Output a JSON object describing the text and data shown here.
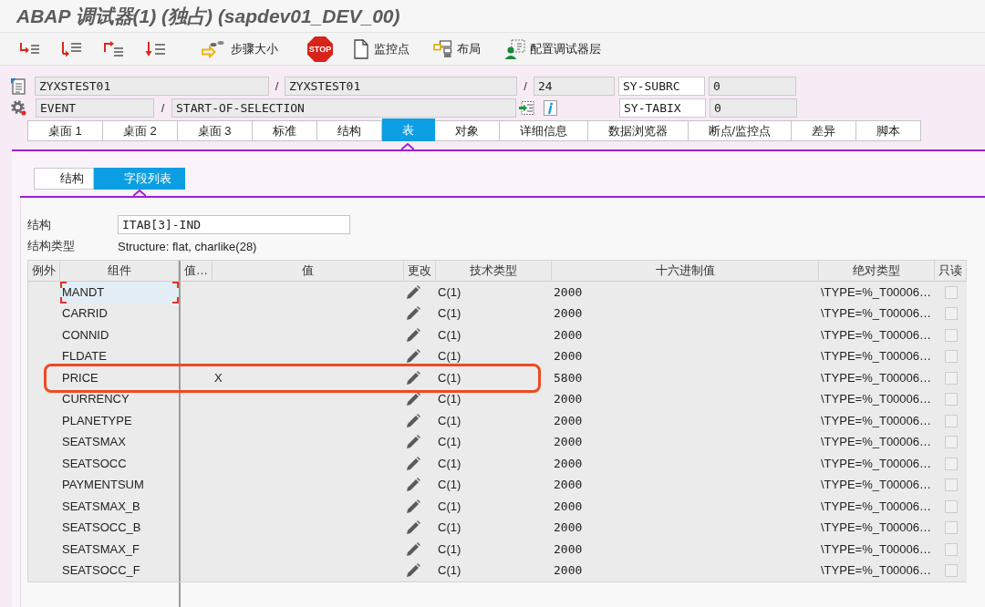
{
  "window": {
    "title": "ABAP 调试器(1) (独占) (sapdev01_DEV_00)"
  },
  "toolbar": {
    "buttons": [
      {
        "kind": "step-into"
      },
      {
        "kind": "execute"
      },
      {
        "kind": "return"
      },
      {
        "kind": "continue"
      },
      {
        "kind": "step-size",
        "label": "步骤大小"
      },
      {
        "kind": "stop",
        "icon_text": "STOP"
      },
      {
        "kind": "watchpoint",
        "label": "监控点"
      },
      {
        "kind": "layout",
        "label": "布局"
      },
      {
        "kind": "layers",
        "label": "配置调试器层"
      }
    ]
  },
  "source_position": {
    "program": "ZYXSTEST01",
    "separator_1": "/",
    "include": "ZYXSTEST01",
    "separator_2": "/",
    "line": "24",
    "system_field": "SY-SUBRC",
    "system_value": "0"
  },
  "event_position": {
    "event_type": "EVENT",
    "separator": "/",
    "event_name": "START-OF-SELECTION",
    "system_field": "SY-TABIX",
    "system_value": "0"
  },
  "tabs": [
    {
      "label": "桌面 1",
      "selected": false
    },
    {
      "label": "桌面 2",
      "selected": false
    },
    {
      "label": "桌面 3",
      "selected": false
    },
    {
      "label": "标准",
      "selected": false
    },
    {
      "label": "结构",
      "selected": false
    },
    {
      "label": "表",
      "selected": true
    },
    {
      "label": "对象",
      "selected": false
    },
    {
      "label": "详细信息",
      "selected": false
    },
    {
      "label": "数据浏览器",
      "selected": false
    },
    {
      "label": "断点/监控点",
      "selected": false
    },
    {
      "label": "差异",
      "selected": false
    },
    {
      "label": "脚本",
      "selected": false
    }
  ],
  "subtabs": [
    {
      "label": "结构",
      "selected": false
    },
    {
      "label": "字段列表",
      "selected": true
    }
  ],
  "structure": {
    "label": "结构",
    "value": "ITAB[3]-IND",
    "type_label": "结构类型",
    "type_value": "Structure: flat, charlike(28)"
  },
  "table": {
    "columns": [
      "例外",
      "组件",
      "值…",
      "值",
      "更改",
      "技术类型",
      "十六进制值",
      "绝对类型",
      "只读"
    ],
    "rows": [
      {
        "component": "MANDT",
        "selected": true,
        "highlighted": false,
        "tech_type": "C(1)",
        "hex_value": "2000",
        "absolute_type": "\\TYPE=%_T00006…",
        "read_only": false
      },
      {
        "component": "CARRID",
        "selected": false,
        "highlighted": false,
        "tech_type": "C(1)",
        "hex_value": "2000",
        "absolute_type": "\\TYPE=%_T00006…",
        "read_only": false
      },
      {
        "component": "CONNID",
        "selected": false,
        "highlighted": false,
        "tech_type": "C(1)",
        "hex_value": "2000",
        "absolute_type": "\\TYPE=%_T00006…",
        "read_only": false
      },
      {
        "component": "FLDATE",
        "selected": false,
        "highlighted": false,
        "tech_type": "C(1)",
        "hex_value": "2000",
        "absolute_type": "\\TYPE=%_T00006…",
        "read_only": false
      },
      {
        "component": "PRICE",
        "selected": false,
        "highlighted": true,
        "value": "X",
        "tech_type": "C(1)",
        "hex_value": "5800",
        "absolute_type": "\\TYPE=%_T00006…",
        "read_only": false
      },
      {
        "component": "CURRENCY",
        "selected": false,
        "highlighted": false,
        "tech_type": "C(1)",
        "hex_value": "2000",
        "absolute_type": "\\TYPE=%_T00006…",
        "read_only": false
      },
      {
        "component": "PLANETYPE",
        "selected": false,
        "highlighted": false,
        "tech_type": "C(1)",
        "hex_value": "2000",
        "absolute_type": "\\TYPE=%_T00006…",
        "read_only": false
      },
      {
        "component": "SEATSMAX",
        "selected": false,
        "highlighted": false,
        "tech_type": "C(1)",
        "hex_value": "2000",
        "absolute_type": "\\TYPE=%_T00006…",
        "read_only": false
      },
      {
        "component": "SEATSOCC",
        "selected": false,
        "highlighted": false,
        "tech_type": "C(1)",
        "hex_value": "2000",
        "absolute_type": "\\TYPE=%_T00006…",
        "read_only": false
      },
      {
        "component": "PAYMENTSUM",
        "selected": false,
        "highlighted": false,
        "tech_type": "C(1)",
        "hex_value": "2000",
        "absolute_type": "\\TYPE=%_T00006…",
        "read_only": false
      },
      {
        "component": "SEATSMAX_B",
        "selected": false,
        "highlighted": false,
        "tech_type": "C(1)",
        "hex_value": "2000",
        "absolute_type": "\\TYPE=%_T00006…",
        "read_only": false
      },
      {
        "component": "SEATSOCC_B",
        "selected": false,
        "highlighted": false,
        "tech_type": "C(1)",
        "hex_value": "2000",
        "absolute_type": "\\TYPE=%_T00006…",
        "read_only": false
      },
      {
        "component": "SEATSMAX_F",
        "selected": false,
        "highlighted": false,
        "tech_type": "C(1)",
        "hex_value": "2000",
        "absolute_type": "\\TYPE=%_T00006…",
        "read_only": false
      },
      {
        "component": "SEATSOCC_F",
        "selected": false,
        "highlighted": false,
        "tech_type": "C(1)",
        "hex_value": "2000",
        "absolute_type": "\\TYPE=%_T00006…",
        "read_only": false
      }
    ]
  }
}
